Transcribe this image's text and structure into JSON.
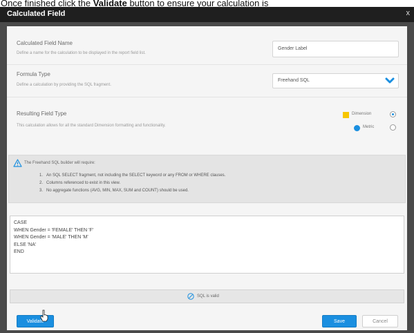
{
  "caption": {
    "before": "Once finished click the ",
    "emphasis": "Validate",
    "after": " button to ensure your calculation is"
  },
  "dialog": {
    "title": "Calculated Field",
    "close_label": "x"
  },
  "fields": {
    "name": {
      "label": "Calculated Field Name",
      "description": "Define a name for the calculation to be displayed in the report field list.",
      "value": "Gender Label"
    },
    "formula_type": {
      "label": "Formula Type",
      "description": "Define a calculation by providing the SQL fragment.",
      "selected": "Freehand SQL"
    },
    "resulting_type": {
      "label": "Resulting Field Type",
      "description": "This calculation allows for all the standard Dimension formatting and functionality.",
      "options": [
        {
          "label": "Dimension",
          "selected": true
        },
        {
          "label": "Metric",
          "selected": false
        }
      ]
    }
  },
  "info": {
    "heading": "The Freehand SQL builder will require:",
    "items": [
      {
        "num": "1.",
        "text": "An SQL SELECT fragment, not including the SELECT keyword or any FROM or WHERE clauses."
      },
      {
        "num": "2.",
        "text": "Columns referenced to exist in this view."
      },
      {
        "num": "3.",
        "text": "No aggregate functions (AVG, MIN, MAX, SUM and COUNT) should be used."
      }
    ]
  },
  "sql": {
    "lines": [
      "CASE",
      "WHEN Gender = 'FEMALE' THEN 'F'",
      "WHEN Gender = 'MALE' THEN 'M'",
      "ELSE 'NA'",
      "END"
    ]
  },
  "status": {
    "text": "SQL is valid"
  },
  "buttons": {
    "validate": "Validate",
    "save": "Save",
    "cancel": "Cancel"
  },
  "colors": {
    "primary": "#1a8fe0",
    "dimension_swatch": "#f7c600",
    "metric_swatch": "#1a8fe0"
  }
}
